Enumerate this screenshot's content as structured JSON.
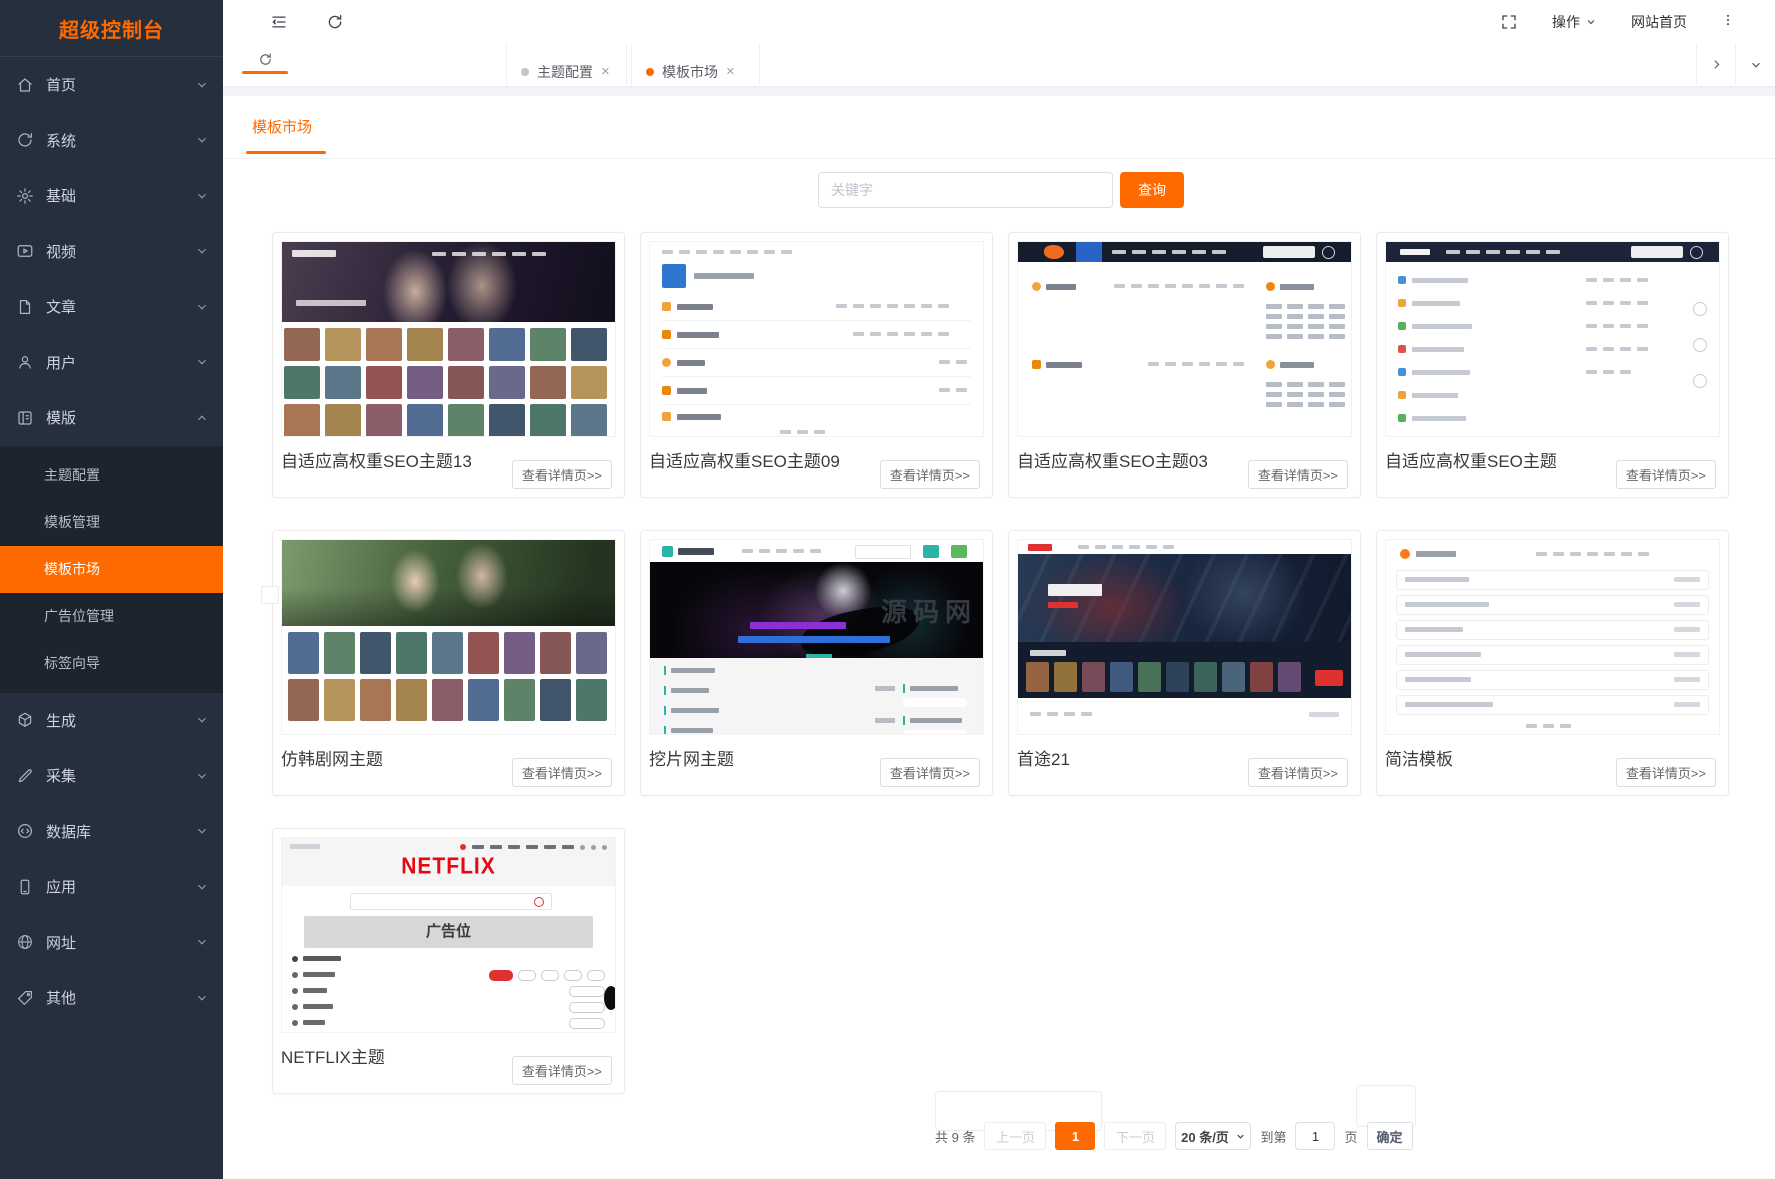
{
  "sidebar": {
    "title": "超级控制台",
    "items": [
      {
        "label": "首页"
      },
      {
        "label": "系统"
      },
      {
        "label": "基础"
      },
      {
        "label": "视频"
      },
      {
        "label": "文章"
      },
      {
        "label": "用户"
      },
      {
        "label": "模版"
      },
      {
        "label": "生成"
      },
      {
        "label": "采集"
      },
      {
        "label": "数据库"
      },
      {
        "label": "应用"
      },
      {
        "label": "网址"
      },
      {
        "label": "其他"
      }
    ],
    "submenu": [
      "主题配置",
      "模板管理",
      "模板市场",
      "广告位管理",
      "标签向导"
    ],
    "active_submenu": "模板市场"
  },
  "topbar": {
    "action_label": "操作",
    "home_link": "网站首页"
  },
  "tabstrip": {
    "tabs": [
      {
        "label": "主题配置"
      },
      {
        "label": "模板市场"
      }
    ]
  },
  "page": {
    "tab": "模板市场",
    "search_placeholder": "关键字",
    "search_button": "查询",
    "detail_label": "查看详情页>>"
  },
  "cards": [
    {
      "title": "自适应高权重SEO主题13"
    },
    {
      "title": "自适应高权重SEO主题09"
    },
    {
      "title": "自适应高权重SEO主题03"
    },
    {
      "title": "自适应高权重SEO主题"
    },
    {
      "title": "仿韩剧网主题"
    },
    {
      "title": "挖片网主题",
      "watermark": "源码网"
    },
    {
      "title": "首途21"
    },
    {
      "title": "简洁模板"
    },
    {
      "title": "NETFLIX主题",
      "logo": "NETFLIX",
      "ad_label": "广告位"
    }
  ],
  "pagination": {
    "total": "共 9 条",
    "prev": "上一页",
    "page": "1",
    "next": "下一页",
    "per_page": "20 条/页",
    "goto_prefix": "到第",
    "goto_value": "1",
    "goto_suffix": "页",
    "confirm": "确定"
  },
  "colors": {
    "accent": "#ff6a00",
    "sidebar_bg": "#262f3d",
    "netflix_red": "#e50914"
  }
}
